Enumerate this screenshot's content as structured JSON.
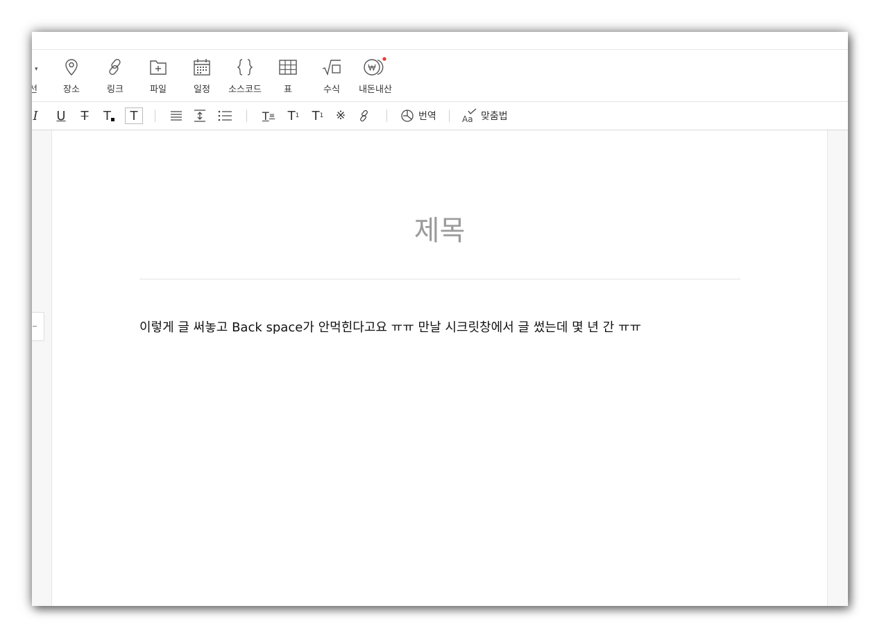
{
  "insert_toolbar": {
    "partial_label": "선",
    "items": [
      {
        "label": "장소",
        "icon": "location-pin-icon"
      },
      {
        "label": "링크",
        "icon": "link-icon"
      },
      {
        "label": "파일",
        "icon": "file-folder-icon"
      },
      {
        "label": "일정",
        "icon": "calendar-icon"
      },
      {
        "label": "소스코드",
        "icon": "curly-braces-icon"
      },
      {
        "label": "표",
        "icon": "table-icon"
      },
      {
        "label": "수식",
        "icon": "square-root-icon"
      },
      {
        "label": "내돈내산",
        "icon": "won-coin-icon"
      }
    ]
  },
  "format_toolbar": {
    "translate_label": "번역",
    "spellcheck_label": "맞춤법"
  },
  "document": {
    "title_placeholder": "제목",
    "body": "이렇게 글 써놓고 Back space가 안먹힌다고요 ㅠㅠ 만날 시크릿창에서 글 썼는데 몇 년 간 ㅠㅠ"
  },
  "colors": {
    "notification_dot": "#e53935",
    "title_placeholder": "#9b9b9b",
    "body_text": "#111111"
  }
}
